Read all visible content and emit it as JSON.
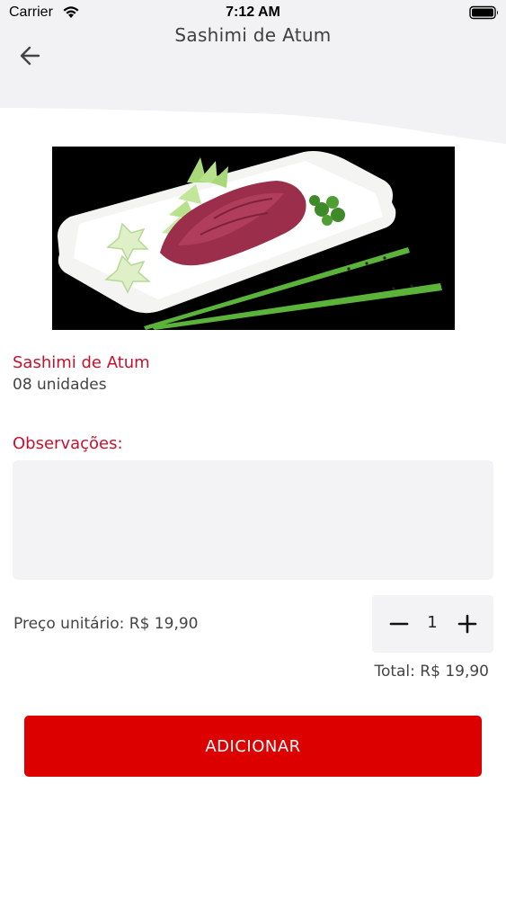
{
  "status_bar": {
    "carrier": "Carrier",
    "time": "7:12 AM",
    "wifi_icon": "wifi-icon",
    "battery_icon": "battery-icon"
  },
  "header": {
    "title": "Sashimi de Atum",
    "back_icon": "arrow-left-icon"
  },
  "product": {
    "name": "Sashimi de Atum",
    "units": "08 unidades",
    "image_alt": "tuna sashimi on white plate with chopsticks"
  },
  "notes": {
    "label": "Observações:",
    "value": ""
  },
  "pricing": {
    "unit_price_text": "Preço unitário: R$ 19,90",
    "quantity": "1",
    "minus_icon": "minus-icon",
    "plus_icon": "plus-icon",
    "total_text": "Total: R$ 19,90"
  },
  "actions": {
    "add_label": "ADICIONAR"
  },
  "colors": {
    "accent_red": "#c8102e",
    "button_red": "#dd0000",
    "surface_gray": "#f3f3f5"
  }
}
